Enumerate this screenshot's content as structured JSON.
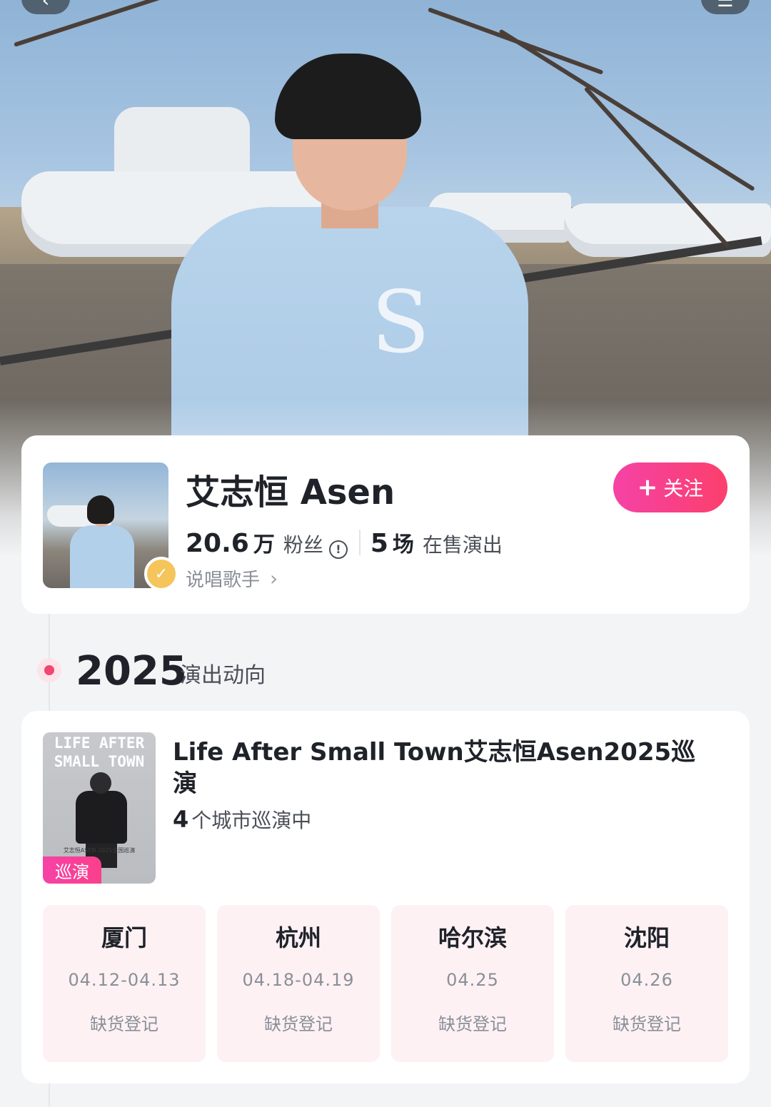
{
  "artist": {
    "name": "艾志恒 Asen",
    "follow_label": "关注",
    "followers_num": "20.6",
    "followers_unit": "万",
    "followers_label": "粉丝",
    "shows_num": "5",
    "shows_unit": "场",
    "shows_label": "在售演出",
    "genre": "说唱歌手"
  },
  "timeline": {
    "year": "2025",
    "subtitle": "演出动向"
  },
  "tour": {
    "poster_title_line1": "LIFE AFTER",
    "poster_title_line2": "SMALL TOWN",
    "poster_caption": "艾志恒ASEN 2025全国巡演",
    "tag": "巡演",
    "title": "Life After Small Town艾志恒Asen2025巡演",
    "city_count": "4",
    "city_count_label": "个城市巡演中",
    "cities": [
      {
        "name": "厦门",
        "date": "04.12-04.13",
        "status": "缺货登记"
      },
      {
        "name": "杭州",
        "date": "04.18-04.19",
        "status": "缺货登记"
      },
      {
        "name": "哈尔滨",
        "date": "04.25",
        "status": "缺货登记"
      },
      {
        "name": "沈阳",
        "date": "04.26",
        "status": "缺货登记"
      }
    ]
  },
  "colors": {
    "accent_pink": "#f542a6",
    "accent_red": "#fb3f6c",
    "timeline_dot": "#f2456f",
    "city_bg": "#fdf1f4",
    "badge_gold": "#f5c55b"
  },
  "icons": {
    "back": "back-icon",
    "menu": "menu-icon",
    "info": "info-icon",
    "verified": "verified-badge-icon",
    "chevron": "chevron-right-icon",
    "plus": "plus-icon"
  }
}
